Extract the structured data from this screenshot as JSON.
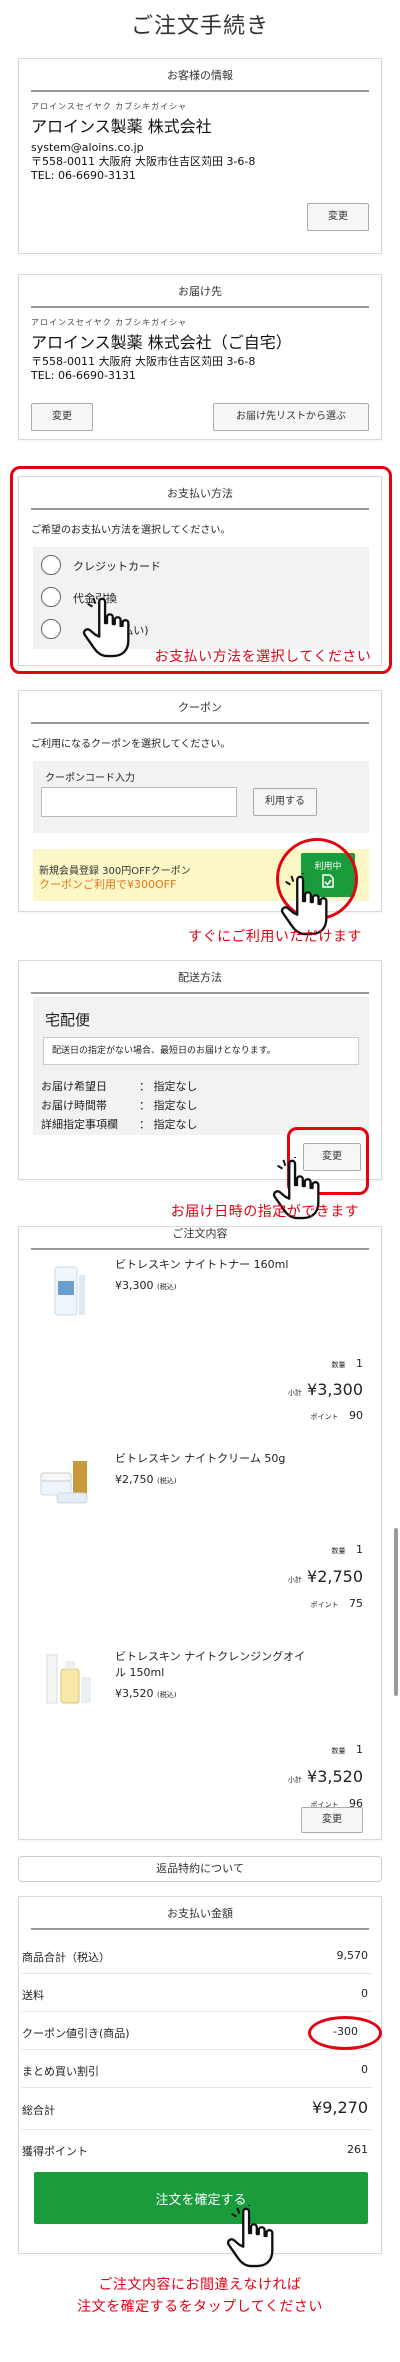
{
  "page": {
    "title": "ご注文手続き"
  },
  "customer": {
    "heading": "お客様の情報",
    "kana": "アロインスセイヤク カブシキガイシャ",
    "company": "アロインス製薬 株式会社",
    "email": "system@aloins.co.jp",
    "address": "〒558-0011 大阪府 大阪市住吉区苅田 3-6-8",
    "tel": "TEL: 06-6690-3131",
    "change_label": "変更"
  },
  "shipping": {
    "heading": "お届け先",
    "kana": "アロインスセイヤク カブシキガイシャ",
    "company": "アロインス製薬 株式会社（ご自宅）",
    "address": "〒558-0011 大阪府 大阪市住吉区苅田 3-6-8",
    "tel": "TEL: 06-6690-3131",
    "change_label": "変更",
    "list_label": "お届け先リストから選ぶ"
  },
  "payment": {
    "heading": "お支払い方法",
    "desc": "ご希望のお支払い方法を選択してください。",
    "options": [
      "クレジットカード",
      "代金引換",
      "(後払い)"
    ],
    "note": "お支払い方法を選択してください"
  },
  "coupon": {
    "heading": "クーポン",
    "desc": "ご利用になるクーポンを選択してください。",
    "code_label": "クーポンコード入力",
    "code_value": "",
    "apply_label": "利用する",
    "offer_title": "新規会員登録 300円OFFクーポン",
    "offer_sub": "クーポンご利用で¥300OFF",
    "use_label": "利用中",
    "note": "すぐにご利用いただけます"
  },
  "delivery": {
    "heading": "配送方法",
    "method": "宅配便",
    "info": "配送日の指定がない場合、最短日のお届けとなります。",
    "rows": [
      {
        "label": "お届け希望日",
        "value": "：  指定なし"
      },
      {
        "label": "お届け時間帯",
        "value": "：  指定なし"
      },
      {
        "label": "詳細指定事項欄",
        "value": "：  指定なし"
      }
    ],
    "change_label": "変更",
    "note": "お届け日時の指定ができます"
  },
  "order": {
    "heading": "ご注文内容",
    "qty_label": "数量",
    "subtotal_label": "小計",
    "point_label": "ポイント",
    "items": [
      {
        "name": "ビトレスキン ナイトトナー 160ml",
        "price": "¥3,300",
        "tax": "(税込)",
        "qty": "1",
        "subtotal": "¥3,300",
        "points": "90"
      },
      {
        "name": "ビトレスキン ナイトクリーム 50g",
        "price": "¥2,750",
        "tax": "(税込)",
        "qty": "1",
        "subtotal": "¥2,750",
        "points": "75"
      },
      {
        "name": "ビトレスキン ナイトクレンジングオイル 150ml",
        "price": "¥3,520",
        "tax": "(税込)",
        "qty": "1",
        "subtotal": "¥3,520",
        "points": "96"
      }
    ],
    "change_label": "変更"
  },
  "returns": {
    "label": "返品特約について"
  },
  "summary": {
    "heading": "お支払い金額",
    "rows": [
      {
        "label": "商品合計（税込）",
        "value": "9,570"
      },
      {
        "label": "送料",
        "value": "0"
      },
      {
        "label": "クーポン値引き(商品)",
        "value": "-300"
      },
      {
        "label": "まとめ買い割引",
        "value": "0"
      }
    ],
    "total_label": "総合計",
    "total_value": "¥9,270",
    "points_label": "獲得ポイント",
    "points_value": "261",
    "confirm_label": "注文を確定する",
    "note_line1": "ご注文内容にお間違えなければ",
    "note_line2": "注文を確定するをタップしてください"
  },
  "colors": {
    "accent_red": "#e50012",
    "confirm_green": "#1a9b3c",
    "coupon_bg": "#fbf7c6"
  }
}
